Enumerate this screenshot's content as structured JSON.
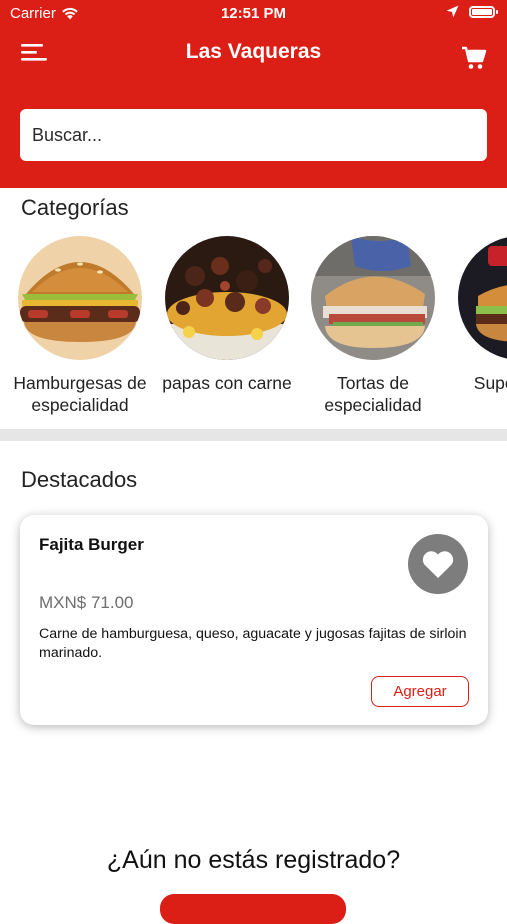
{
  "status_bar": {
    "carrier": "Carrier",
    "time": "12:51 PM",
    "battery_level": 1.0
  },
  "header": {
    "title": "Las Vaqueras",
    "menu_icon": "menu-icon",
    "cart_icon": "cart-icon",
    "background_color": "#dc1f16"
  },
  "search": {
    "placeholder": "Buscar...",
    "value": ""
  },
  "categories": {
    "title": "Categorías",
    "items": [
      {
        "label": "Hamburgesas de especialidad"
      },
      {
        "label": "papas con carne"
      },
      {
        "label": "Tortas de especialidad"
      },
      {
        "label": "Super Supe"
      }
    ]
  },
  "featured": {
    "title": "Destacados",
    "items": [
      {
        "name": "Fajita Burger",
        "price": "MXN$ 71.00",
        "description": "Carne de hamburguesa, queso, aguacate y jugosas fajitas de sirloin marinado.",
        "add_label": "Agregar",
        "favorite_icon": "heart-icon"
      }
    ]
  },
  "register": {
    "question": "¿Aún no estás registrado?"
  },
  "colors": {
    "accent": "#dc1f16",
    "card_bg": "#ffffff",
    "fav_bg": "#7d7d7d"
  }
}
